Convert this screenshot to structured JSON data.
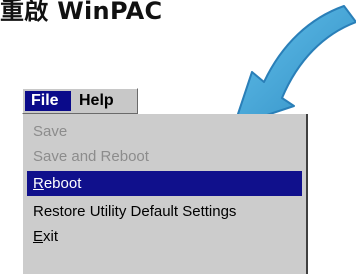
{
  "heading": {
    "text": "重啟 WinPAC"
  },
  "arrow": {
    "icon": "curved-arrow-icon",
    "color": "#4aa6d6"
  },
  "menubar": {
    "file_label": "File",
    "help_label": "Help"
  },
  "file_menu": {
    "items": [
      {
        "label": "Save",
        "state": "disabled"
      },
      {
        "label": "Save and Reboot",
        "state": "disabled"
      },
      {
        "mnemonic": "R",
        "rest": "eboot",
        "state": "selected"
      },
      {
        "label": "Restore Utility Default Settings",
        "state": "enabled"
      },
      {
        "mnemonic": "E",
        "rest": "xit",
        "state": "enabled"
      }
    ]
  },
  "colors": {
    "menu_background": "#cccccc",
    "highlight": "#10108c",
    "disabled_text": "#8c8c8c"
  }
}
